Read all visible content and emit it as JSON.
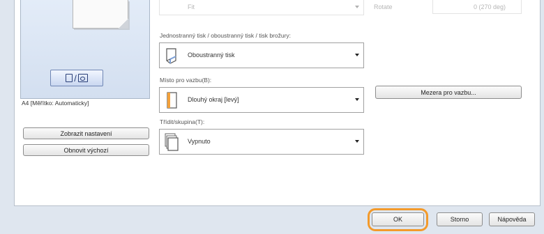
{
  "dialog": {
    "top_row": {
      "paper_value": "Fit",
      "right_label": "Rotate",
      "right_value": "0 (270 deg)"
    },
    "preview": {
      "page_size_text": "A4 [Měřítko: Automaticky]",
      "mode_icon": "single-duplex-toggle-icon"
    },
    "buttons": {
      "show_settings": "Zobrazit nastavení",
      "restore_defaults": "Obnovit výchozí",
      "binding_margin": "Mezera pro vazbu...",
      "ok": "OK",
      "cancel": "Storno",
      "help": "Nápověda"
    },
    "fields": {
      "print_mode": {
        "label": "Jednostranný tisk / oboustranný tisk / tisk brožury:",
        "value": "Oboustranný tisk",
        "icon": "duplex-page-icon"
      },
      "binding_location": {
        "label": "Místo pro vazbu(B):",
        "value": "Dlouhý okraj [levý]",
        "icon": "binding-edge-icon"
      },
      "collate": {
        "label": "Třídit/skupina(T):",
        "value": "Vypnuto",
        "icon": "collate-off-icon"
      }
    },
    "highlight_color": "#f39a2b"
  }
}
